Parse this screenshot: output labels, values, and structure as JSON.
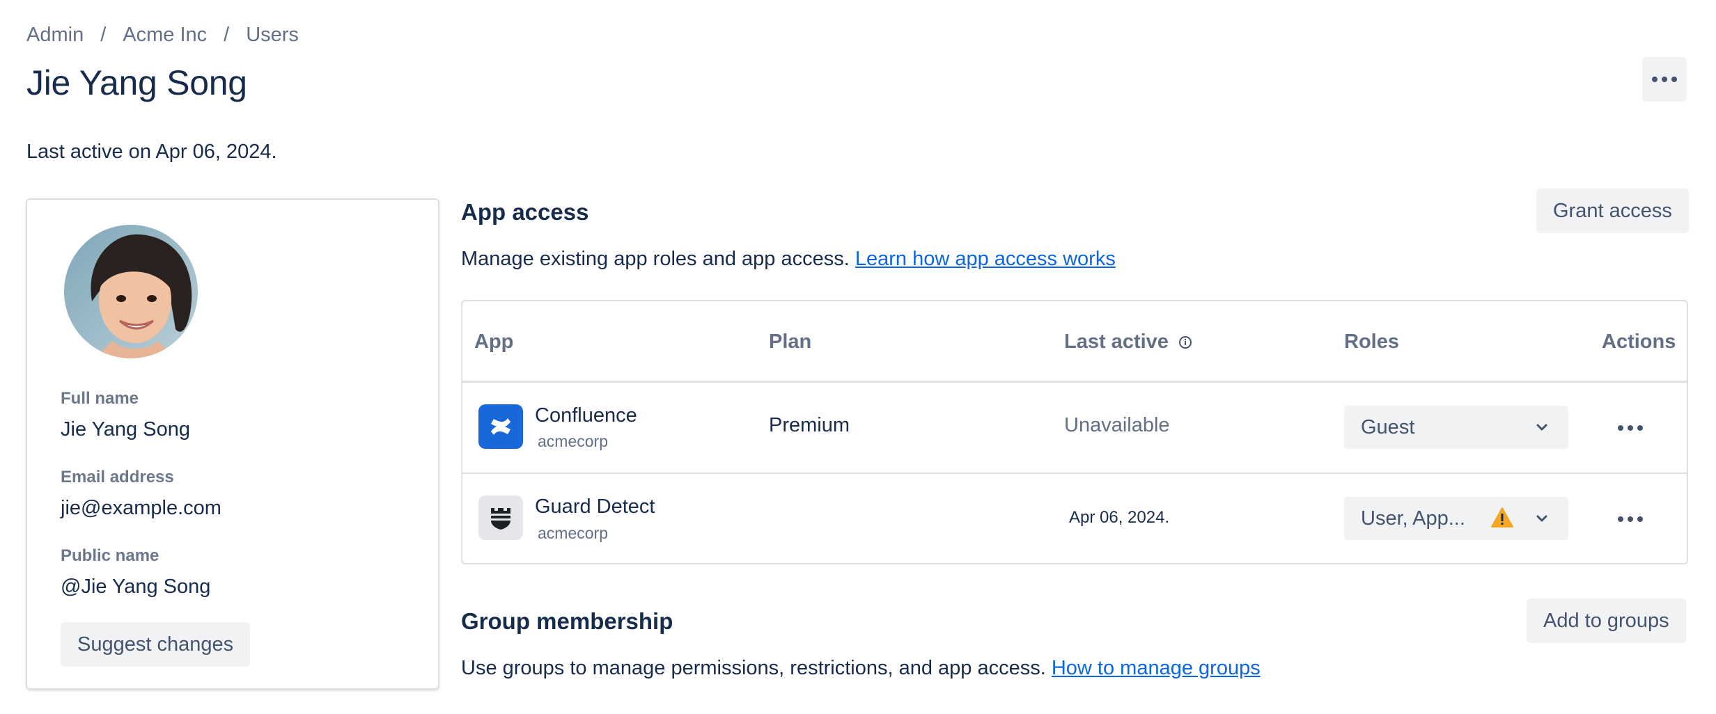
{
  "breadcrumb": [
    "Admin",
    "Acme Inc",
    "Users"
  ],
  "breadcrumb_separator": "/",
  "page_title": "Jie Yang Song",
  "last_active_text": "Last active on Apr 06, 2024.",
  "profile": {
    "full_name_label": "Full name",
    "full_name": "Jie Yang Song",
    "email_label": "Email address",
    "email": "jie@example.com",
    "public_name_label": "Public name",
    "public_name": "@Jie Yang Song",
    "suggest_button": "Suggest changes"
  },
  "app_access": {
    "title": "App access",
    "description": "Manage existing app roles and app access.",
    "link": "Learn how app access works",
    "grant_button": "Grant access",
    "columns": [
      "App",
      "Plan",
      "Last active",
      "Roles",
      "Actions"
    ],
    "rows": [
      {
        "app": "Confluence",
        "site": "acmecorp",
        "plan": "Premium",
        "last_active": "Unavailable",
        "roles": "Guest",
        "icon": "confluence-icon"
      },
      {
        "app": "Guard Detect",
        "site": "acmecorp",
        "plan": "",
        "last_active": "Apr 06, 2024.",
        "roles": "User, App...",
        "icon": "guard-detect-icon",
        "warning": true
      }
    ]
  },
  "group_membership": {
    "title": "Group membership",
    "description": "Use groups to manage permissions, restrictions, and app access.",
    "link": "How to manage groups",
    "add_button": "Add to groups"
  },
  "colors": {
    "text": "#172b4d",
    "subtle": "#626f86",
    "link": "#0c66e4",
    "button_bg": "#f1f2f4",
    "border": "#dcdfe4",
    "confluence_blue": "#1868db",
    "warning": "#f5a623"
  }
}
